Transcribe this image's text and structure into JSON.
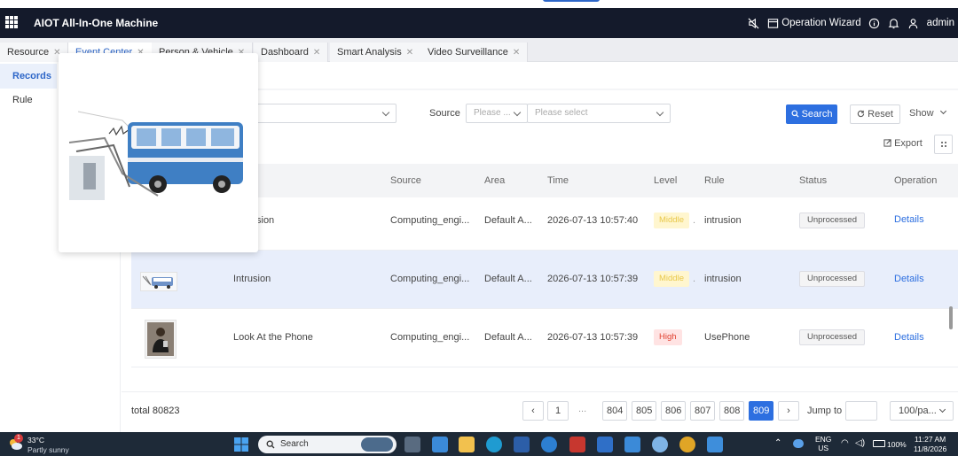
{
  "header": {
    "app_title": "AIOT All-In-One Machine",
    "operation_wizard": "Operation Wizard",
    "user": "admin"
  },
  "tabs": [
    {
      "label": "Resource"
    },
    {
      "label": "Event Center"
    },
    {
      "label": "Person & Vehicle"
    },
    {
      "label": "Dashboard"
    },
    {
      "label": "Smart Analysis"
    },
    {
      "label": "Video Surveillance"
    }
  ],
  "sidebar": {
    "items": [
      {
        "label": "Records"
      },
      {
        "label": "Rule"
      }
    ]
  },
  "filters": {
    "source_label": "Source",
    "source_type_placeholder": "Please ...",
    "source_placeholder": "Please select",
    "search_label": "Search",
    "reset_label": "Reset",
    "show_label": "Show",
    "export_label": "Export"
  },
  "table": {
    "columns": [
      "Source",
      "Area",
      "Time",
      "Level",
      "Rule",
      "Status",
      "Operation"
    ],
    "rows": [
      {
        "event": "Intrusion",
        "event_visible": "sion",
        "source": "Computing_engi...",
        "area": "Default A...",
        "time": "2026-07-13 10:57:40",
        "level": "Middle",
        "rule": "intrusion",
        "status": "Unprocessed",
        "operation": "Details"
      },
      {
        "event": "Intrusion",
        "source": "Computing_engi...",
        "area": "Default A...",
        "time": "2026-07-13 10:57:39",
        "level": "Middle",
        "rule": "intrusion",
        "status": "Unprocessed",
        "operation": "Details"
      },
      {
        "event": "Look At the Phone",
        "source": "Computing_engi...",
        "area": "Default A...",
        "time": "2026-07-13 10:57:39",
        "level": "High",
        "rule": "UsePhone",
        "status": "Unprocessed",
        "operation": "Details"
      }
    ]
  },
  "pagination": {
    "total": "total 80823",
    "pages": [
      "1",
      "...",
      "804",
      "805",
      "806",
      "807",
      "808",
      "809"
    ],
    "current": "809",
    "jump_label": "Jump to",
    "page_size": "100/pa..."
  },
  "taskbar": {
    "temperature": "33°C",
    "weather": "Partly sunny",
    "weather_badge": "1",
    "search_label": "Search",
    "language": "ENG",
    "region": "US",
    "battery": "100%",
    "time": "11:27 AM",
    "date": "11/8/2026"
  },
  "colors": {
    "header_bg": "#141a2b",
    "accent": "#2d6fe0",
    "middle_level": "#e8c84a",
    "high_level": "#e0402f"
  }
}
